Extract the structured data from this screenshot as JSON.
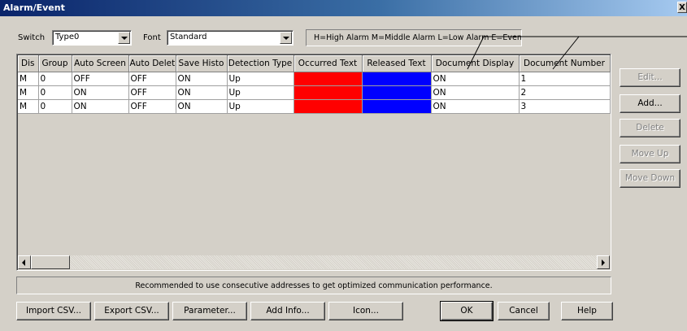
{
  "window": {
    "title": "Alarm/Event",
    "close_label": "X"
  },
  "switch": {
    "label": "Switch",
    "value": "Type0"
  },
  "font": {
    "label": "Font",
    "value": "Standard"
  },
  "legend_text": "H=High Alarm M=Middle Alarm L=Low Alarm E=Event",
  "table": {
    "columns": [
      "Dis",
      "Group",
      "Auto Screen",
      "Auto Delet",
      "Save Histo",
      "Detection Type",
      "Occurred Text",
      "Released Text",
      "Document Display",
      "Document Number"
    ],
    "rows": [
      {
        "dis": "M",
        "group": "0",
        "auto_screen": "OFF",
        "auto_delet": "OFF",
        "save_histo": "ON",
        "detection_type": "Up",
        "document_display": "ON",
        "document_number": "1"
      },
      {
        "dis": "M",
        "group": "0",
        "auto_screen": "ON",
        "auto_delet": "OFF",
        "save_histo": "ON",
        "detection_type": "Up",
        "document_display": "ON",
        "document_number": "2"
      },
      {
        "dis": "M",
        "group": "0",
        "auto_screen": "ON",
        "auto_delet": "OFF",
        "save_histo": "ON",
        "detection_type": "Up",
        "document_display": "ON",
        "document_number": "3"
      }
    ],
    "occurred_color": "#ff0000",
    "released_color": "#0000ff"
  },
  "side_buttons": {
    "edit": "Edit...",
    "add": "Add...",
    "delete": "Delete",
    "move_up": "Move Up",
    "move_down": "Move Down"
  },
  "status_text": "Recommended to use consecutive addresses to get optimized communication performance.",
  "bottom_buttons": {
    "import_csv": "Import CSV...",
    "export_csv": "Export CSV...",
    "parameter": "Parameter...",
    "add_info": "Add Info...",
    "icon": "Icon...",
    "ok": "OK",
    "cancel": "Cancel",
    "help": "Help"
  },
  "colors": {
    "face": "#d4d0c8",
    "title_start": "#0a246a",
    "title_end": "#a6caf0"
  }
}
